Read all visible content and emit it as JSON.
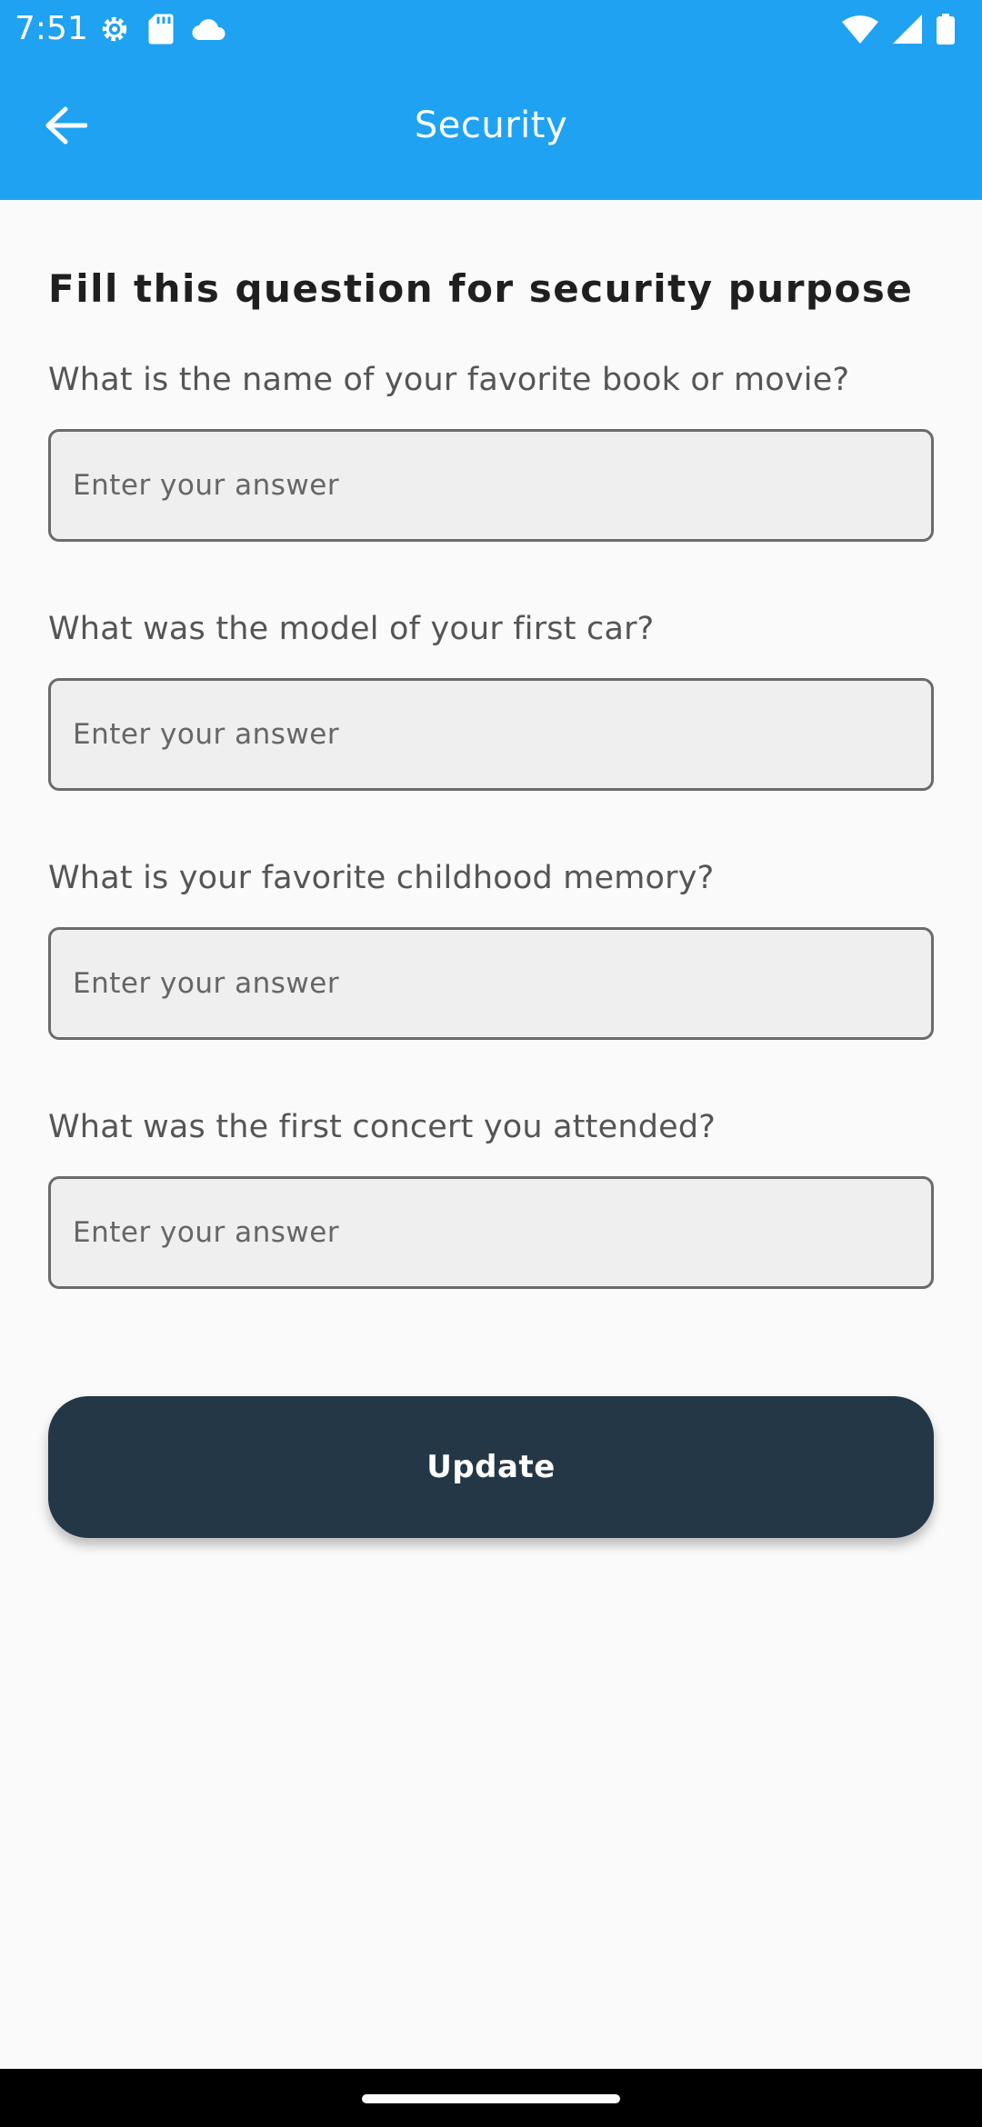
{
  "status_bar": {
    "time": "7:51",
    "icons_left": [
      "settings-gear-icon",
      "sd-card-icon",
      "cloud-icon"
    ],
    "icons_right": [
      "wifi-icon",
      "cellular-signal-icon",
      "battery-icon"
    ]
  },
  "app_bar": {
    "title": "Security",
    "back_icon": "arrow-left-icon",
    "color": "#1fa2f1"
  },
  "form": {
    "heading": "Fill this question for security purpose",
    "questions": [
      {
        "label": "What is the name of your favorite book or movie?",
        "value": "",
        "placeholder": "Enter your answer"
      },
      {
        "label": "What was the model of your first car?",
        "value": "",
        "placeholder": "Enter your answer"
      },
      {
        "label": "What is your favorite childhood memory?",
        "value": "",
        "placeholder": "Enter your answer"
      },
      {
        "label": "What was the first concert you attended?",
        "value": "",
        "placeholder": "Enter your answer"
      }
    ],
    "submit_label": "Update",
    "submit_color": "#243746"
  }
}
